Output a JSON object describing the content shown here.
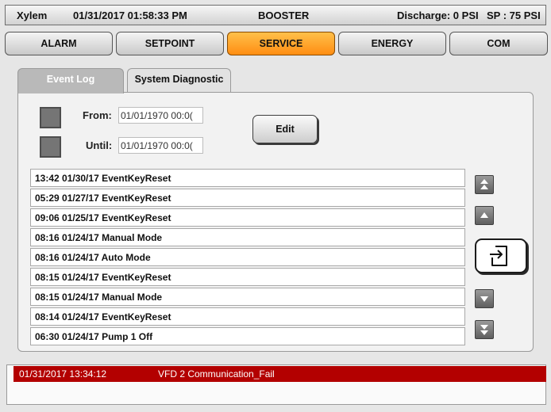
{
  "status_bar": {
    "brand": "Xylem",
    "datetime": "01/31/2017 01:58:33 PM",
    "screen": "BOOSTER",
    "discharge": "Discharge: 0 PSI",
    "setpoint": "SP : 75 PSI"
  },
  "main_menu": {
    "items": [
      {
        "label": "ALARM"
      },
      {
        "label": "SETPOINT"
      },
      {
        "label": "SERVICE",
        "active": true
      },
      {
        "label": "ENERGY"
      },
      {
        "label": "COM"
      }
    ]
  },
  "tabs": [
    {
      "label": "Event Log",
      "active": true
    },
    {
      "label": "System Diagnostic"
    }
  ],
  "filter": {
    "from_label": "From:",
    "from_value": "01/01/1970 00:0(",
    "until_label": "Until:",
    "until_value": "01/01/1970 00:0(",
    "edit_label": "Edit"
  },
  "events": [
    {
      "text": "13:42  01/30/17  EventKeyReset"
    },
    {
      "text": "05:29  01/27/17  EventKeyReset"
    },
    {
      "text": "09:06  01/25/17  EventKeyReset"
    },
    {
      "text": "08:16  01/24/17  Manual Mode"
    },
    {
      "text": "08:16  01/24/17  Auto Mode"
    },
    {
      "text": "08:15  01/24/17  EventKeyReset"
    },
    {
      "text": "08:15  01/24/17  Manual Mode"
    },
    {
      "text": "08:14  01/24/17  EventKeyReset"
    },
    {
      "text": "06:30  01/24/17  Pump 1 Off"
    }
  ],
  "nav": {
    "icons": {
      "first": "double-chevron-up-icon",
      "up": "triangle-up-icon",
      "export": "export-document-icon",
      "down": "triangle-down-icon",
      "last": "double-chevron-down-icon"
    }
  },
  "alarm": {
    "time": "01/31/2017 13:34:12",
    "message": "VFD 2 Communication_Fail",
    "color": "#b30000"
  },
  "colors": {
    "active_tab": "#ff8d12",
    "panel": "#f2f2f2",
    "alarm": "#b30000"
  }
}
